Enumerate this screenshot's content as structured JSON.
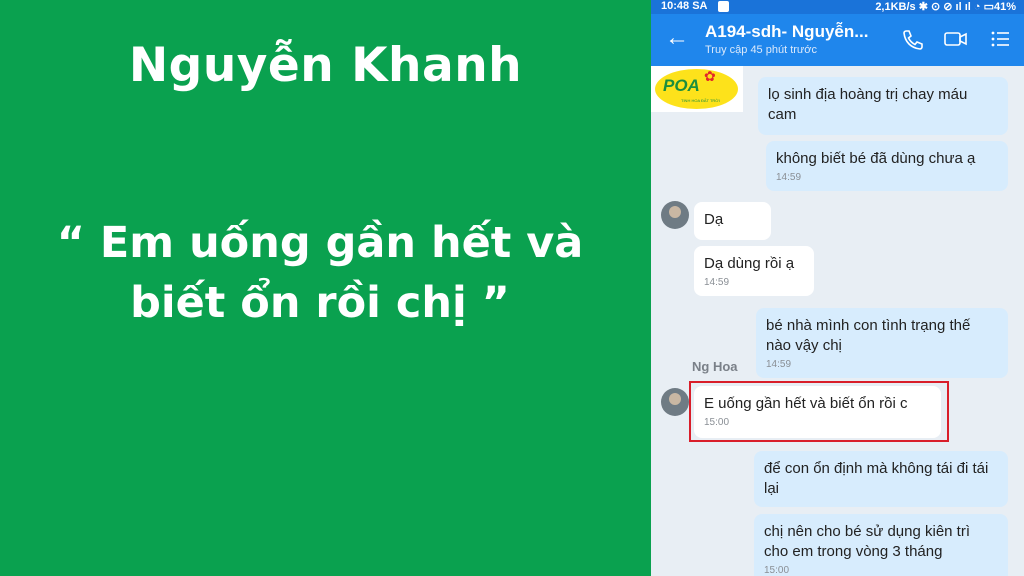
{
  "slide": {
    "name": "Nguyễn Khanh",
    "quote_line1": "“ Em uống gần hết và",
    "quote_line2": "biết ổn rồi chị ”"
  },
  "status_bar": {
    "time": "10:48 SA",
    "right": "2,1KB/s ✱ ⊙ ⊘ ıl ıl ◔ ▭41%"
  },
  "chat_header": {
    "title": "A194-sdh- Nguyễn...",
    "subtitle": "Truy cập 45 phút trước",
    "icons": [
      "back-arrow-icon",
      "phone-icon",
      "video-icon",
      "menu-list-icon"
    ]
  },
  "logo": {
    "text": "POA",
    "tagline": "TINH HOA ĐẤT TRỜI"
  },
  "messages": [
    {
      "side": "sent",
      "text": "lọ sinh địa hoàng trị chay máu cam",
      "time": ""
    },
    {
      "side": "sent",
      "text": "không biết bé đã dùng chưa ạ",
      "time": "14:59"
    },
    {
      "side": "recv",
      "text": "Dạ",
      "time": ""
    },
    {
      "side": "recv",
      "text": "Dạ dùng rồi ạ",
      "time": "14:59"
    },
    {
      "side": "sent",
      "text": "bé nhà mình con tình trạng thế nào vậy chị",
      "time": "14:59"
    },
    {
      "side": "recv",
      "sender": "Ng Hoa",
      "text": "E uống gần hết và biết ổn rồi c",
      "time": "15:00"
    },
    {
      "side": "sent",
      "text": "để con ổn định mà không tái đi tái lại",
      "time": ""
    },
    {
      "side": "sent",
      "text": "chị nên cho bé sử dụng kiên trì cho em trong vòng 3 tháng",
      "time": "15:00"
    }
  ],
  "colors": {
    "slide_green": "#0aa14f",
    "header_blue": "#1f86ec",
    "sent_bubble": "#d7ecfd",
    "highlight_red": "#d91e2a"
  }
}
